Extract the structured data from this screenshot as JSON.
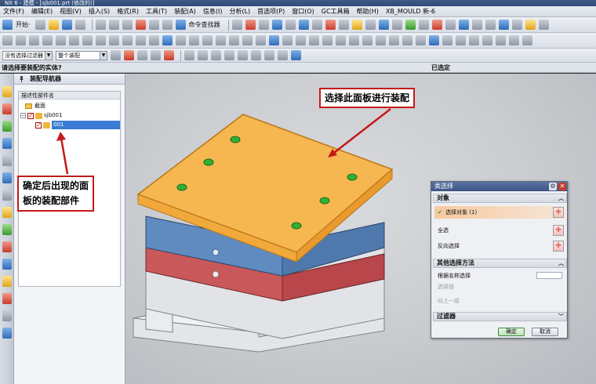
{
  "window": {
    "title": "NX 6 - 建模 - [sjb001.prt (修改的)]"
  },
  "menu": [
    "文件(F)",
    "编辑(E)",
    "视图(V)",
    "插入(S)",
    "格式(R)",
    "工具(T)",
    "装配(A)",
    "信息(I)",
    "分析(L)",
    "首选项(P)",
    "窗口(O)",
    "GC工具箱",
    "帮助(H)",
    "XB_MOULD 新-6"
  ],
  "toolbar": {
    "start_label": "开始·",
    "command_finder": "命令查找器"
  },
  "selection_bar": {
    "filter_value": "没有选择过滤器",
    "scope_value": "整个装配"
  },
  "cue": {
    "prompt": "请选择要装配的实体?",
    "status": "已选定"
  },
  "navigator": {
    "title": "装配导航器",
    "column_header": "描述性部件名",
    "nodes": [
      {
        "label": "截面"
      },
      {
        "label": "sjb001"
      },
      {
        "label": "001"
      }
    ]
  },
  "callouts": {
    "top": "选择此面板进行装配",
    "left_line1": "确定后出现的面",
    "left_line2": "板的装配部件"
  },
  "dialog": {
    "title": "类选择",
    "group_object": "对象",
    "select_object": "选择对象 (1)",
    "select_all": "全选",
    "invert": "反向选择",
    "group_other": "其他选择方法",
    "by_name": "根据名称选择",
    "chain": "选择链",
    "up_one": "向上一级",
    "group_filter": "过滤器",
    "ok": "确定",
    "cancel": "取消"
  },
  "colors": {
    "plate_top": "#f4b24a",
    "plate_blue": "#5d88bd",
    "plate_red": "#c45a5a",
    "accent_red": "#c41a1a",
    "hole_green": "#32b032"
  }
}
